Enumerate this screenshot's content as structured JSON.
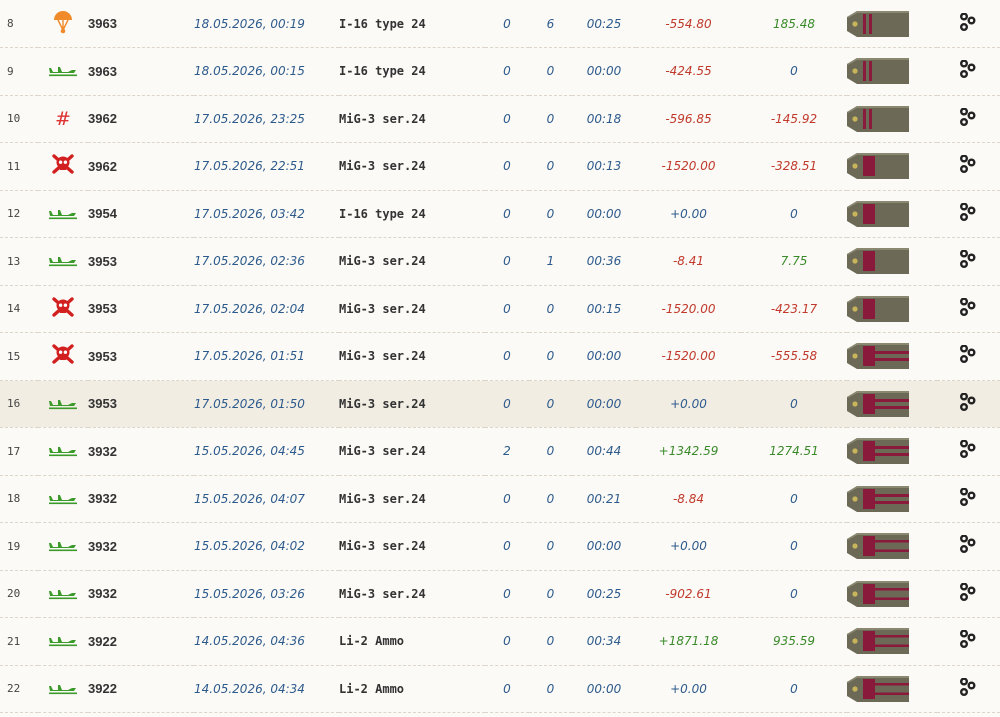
{
  "colors": {
    "negative": "#c0392b",
    "positive": "#3a8a2a",
    "neutral": "#2d5a8c"
  },
  "rows": [
    {
      "num": "8",
      "status": "parachute-icon",
      "tour": "3963",
      "date": "18.05.2026, 00:19",
      "aircraft": "I-16 type 24",
      "kills": "0",
      "ground": "6",
      "time": "00:25",
      "score": "-554.80",
      "score_color": "neg",
      "points": "185.48",
      "points_color": "pos",
      "rank": "1",
      "highlight": false
    },
    {
      "num": "9",
      "status": "landed-plane-icon",
      "tour": "3963",
      "date": "18.05.2026, 00:15",
      "aircraft": "I-16 type 24",
      "kills": "0",
      "ground": "0",
      "time": "00:00",
      "score": "-424.55",
      "score_color": "neg",
      "points": "0",
      "points_color": "neu",
      "rank": "1",
      "highlight": false
    },
    {
      "num": "10",
      "status": "hash-icon",
      "tour": "3962",
      "date": "17.05.2026, 23:25",
      "aircraft": "MiG-3 ser.24",
      "kills": "0",
      "ground": "0",
      "time": "00:18",
      "score": "-596.85",
      "score_color": "neg",
      "points": "-145.92",
      "points_color": "neg",
      "rank": "1",
      "highlight": false
    },
    {
      "num": "11",
      "status": "skull-icon",
      "tour": "3962",
      "date": "17.05.2026, 22:51",
      "aircraft": "MiG-3 ser.24",
      "kills": "0",
      "ground": "0",
      "time": "00:13",
      "score": "-1520.00",
      "score_color": "neg",
      "points": "-328.51",
      "points_color": "neg",
      "rank": "2",
      "highlight": false
    },
    {
      "num": "12",
      "status": "landed-plane-icon",
      "tour": "3954",
      "date": "17.05.2026, 03:42",
      "aircraft": "I-16 type 24",
      "kills": "0",
      "ground": "0",
      "time": "00:00",
      "score": "+0.00",
      "score_color": "neu",
      "points": "0",
      "points_color": "neu",
      "rank": "2",
      "highlight": false
    },
    {
      "num": "13",
      "status": "landed-plane-icon",
      "tour": "3953",
      "date": "17.05.2026, 02:36",
      "aircraft": "MiG-3 ser.24",
      "kills": "0",
      "ground": "1",
      "time": "00:36",
      "score": "-8.41",
      "score_color": "neg",
      "points": "7.75",
      "points_color": "pos",
      "rank": "2",
      "highlight": false
    },
    {
      "num": "14",
      "status": "skull-icon",
      "tour": "3953",
      "date": "17.05.2026, 02:04",
      "aircraft": "MiG-3 ser.24",
      "kills": "0",
      "ground": "0",
      "time": "00:15",
      "score": "-1520.00",
      "score_color": "neg",
      "points": "-423.17",
      "points_color": "neg",
      "rank": "2",
      "highlight": false
    },
    {
      "num": "15",
      "status": "skull-icon",
      "tour": "3953",
      "date": "17.05.2026, 01:51",
      "aircraft": "MiG-3 ser.24",
      "kills": "0",
      "ground": "0",
      "time": "00:00",
      "score": "-1520.00",
      "score_color": "neg",
      "points": "-555.58",
      "points_color": "neg",
      "rank": "3",
      "highlight": false
    },
    {
      "num": "16",
      "status": "landed-plane-icon",
      "tour": "3953",
      "date": "17.05.2026, 01:50",
      "aircraft": "MiG-3 ser.24",
      "kills": "0",
      "ground": "0",
      "time": "00:00",
      "score": "+0.00",
      "score_color": "neu",
      "points": "0",
      "points_color": "neu",
      "rank": "3",
      "highlight": true
    },
    {
      "num": "17",
      "status": "landed-plane-icon",
      "tour": "3932",
      "date": "15.05.2026, 04:45",
      "aircraft": "MiG-3 ser.24",
      "kills": "2",
      "ground": "0",
      "time": "00:44",
      "score": "+1342.59",
      "score_color": "pos",
      "points": "1274.51",
      "points_color": "pos",
      "rank": "3",
      "highlight": false
    },
    {
      "num": "18",
      "status": "landed-plane-icon",
      "tour": "3932",
      "date": "15.05.2026, 04:07",
      "aircraft": "MiG-3 ser.24",
      "kills": "0",
      "ground": "0",
      "time": "00:21",
      "score": "-8.84",
      "score_color": "neg",
      "points": "0",
      "points_color": "neu",
      "rank": "3",
      "highlight": false
    },
    {
      "num": "19",
      "status": "landed-plane-icon",
      "tour": "3932",
      "date": "15.05.2026, 04:02",
      "aircraft": "MiG-3 ser.24",
      "kills": "0",
      "ground": "0",
      "time": "00:00",
      "score": "+0.00",
      "score_color": "neu",
      "points": "0",
      "points_color": "neu",
      "rank": "4",
      "highlight": false
    },
    {
      "num": "20",
      "status": "landed-plane-icon",
      "tour": "3932",
      "date": "15.05.2026, 03:26",
      "aircraft": "MiG-3 ser.24",
      "kills": "0",
      "ground": "0",
      "time": "00:25",
      "score": "-902.61",
      "score_color": "neg",
      "points": "0",
      "points_color": "neu",
      "rank": "4",
      "highlight": false
    },
    {
      "num": "21",
      "status": "landed-plane-icon",
      "tour": "3922",
      "date": "14.05.2026, 04:36",
      "aircraft": "Li-2 Ammo",
      "kills": "0",
      "ground": "0",
      "time": "00:34",
      "score": "+1871.18",
      "score_color": "pos",
      "points": "935.59",
      "points_color": "pos",
      "rank": "4",
      "highlight": false
    },
    {
      "num": "22",
      "status": "landed-plane-icon",
      "tour": "3922",
      "date": "14.05.2026, 04:34",
      "aircraft": "Li-2 Ammo",
      "kills": "0",
      "ground": "0",
      "time": "00:00",
      "score": "+0.00",
      "score_color": "neu",
      "points": "0",
      "points_color": "neu",
      "rank": "4",
      "highlight": false
    }
  ]
}
